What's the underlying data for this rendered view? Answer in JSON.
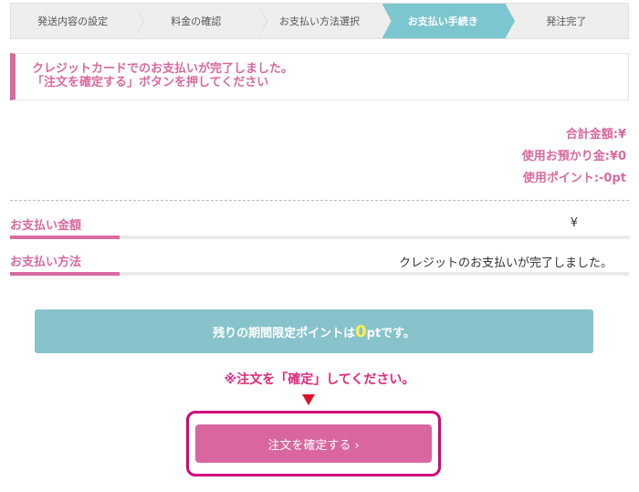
{
  "steps": [
    {
      "label": "発送内容の設定",
      "active": false
    },
    {
      "label": "料金の確認",
      "active": false
    },
    {
      "label": "お支払い方法選択",
      "active": false
    },
    {
      "label": "お支払い手続き",
      "active": true
    },
    {
      "label": "発注完了",
      "active": false
    }
  ],
  "notice": {
    "line1": "クレジットカードでのお支払いが完了しました。",
    "line2": "「注文を確定する」ボタンを押してください"
  },
  "totals": {
    "total": "合計金額:¥",
    "deposit": "使用お預かり金:¥0",
    "points": "使用ポイント:-0pt"
  },
  "payment_amount": {
    "label": "お支払い金額",
    "value": "¥"
  },
  "payment_method": {
    "label": "お支払い方法",
    "value": "クレジットのお支払いが完了しました。"
  },
  "limited_points": {
    "prefix": "残りの期間限定ポイントは",
    "value": "0",
    "suffix": "ptです。"
  },
  "confirm_note": "※注文を「確定」してください。",
  "confirm_button": "注文を確定する ›",
  "colors": {
    "accent_pink": "#d9699f",
    "active_step": "#7cc6d0",
    "points_bar": "#88c3cc",
    "highlight_yellow": "#fff14a"
  }
}
